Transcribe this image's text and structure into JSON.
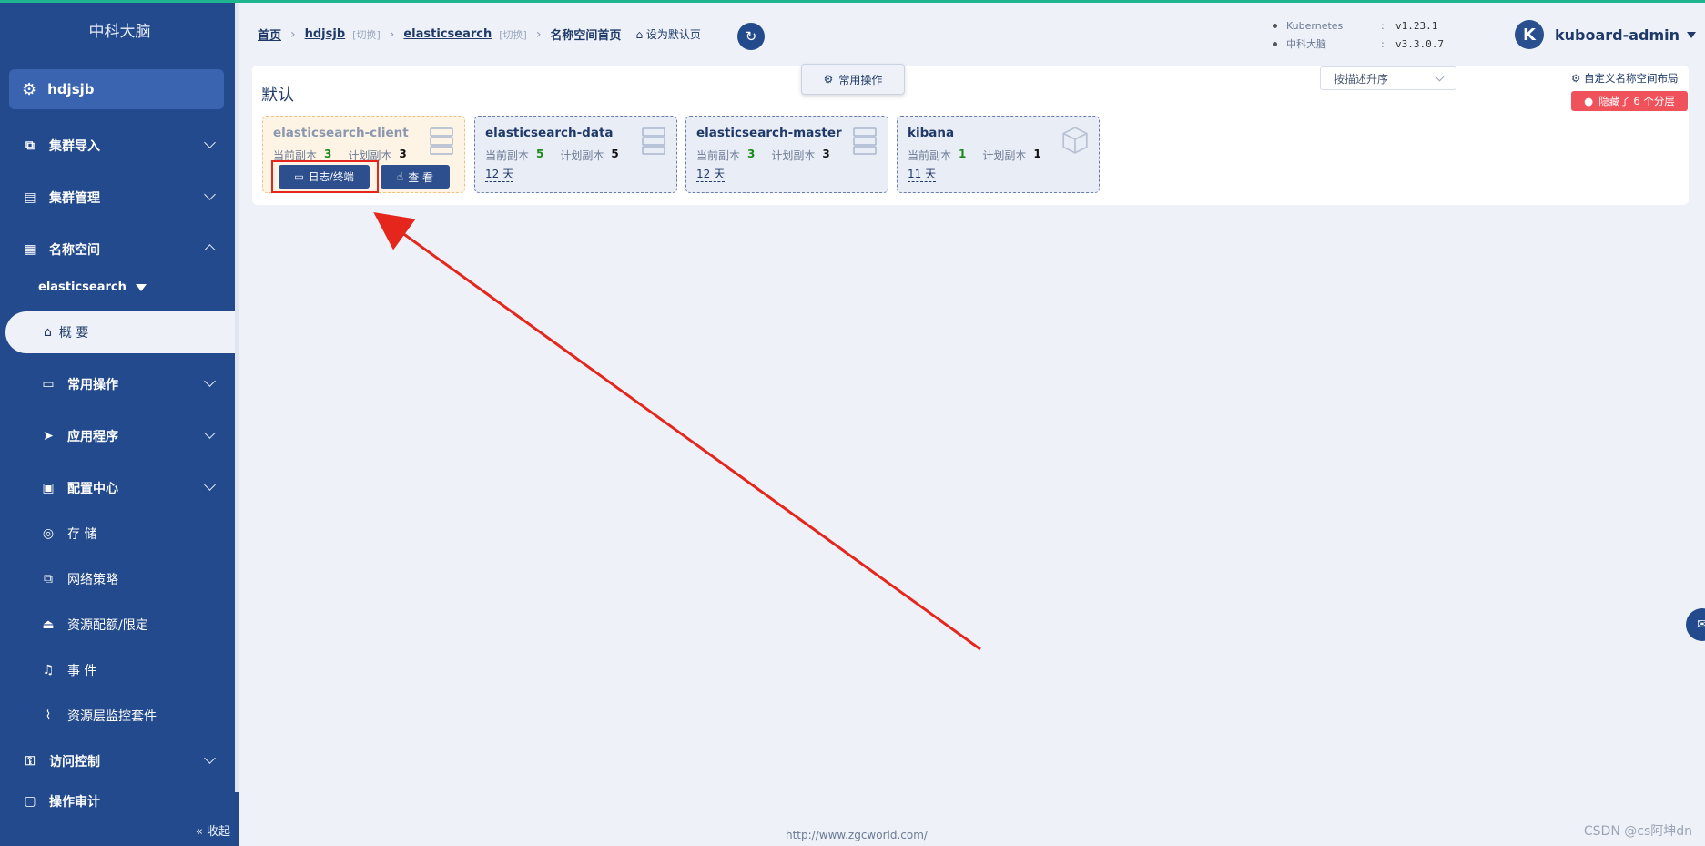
{
  "sidebar": {
    "title": "中科大脑",
    "cluster": "hdjsjb",
    "items": [
      {
        "label": "集群导入"
      },
      {
        "label": "集群管理"
      },
      {
        "label": "名称空间"
      },
      {
        "label": "常用操作"
      },
      {
        "label": "应用程序"
      },
      {
        "label": "配置中心"
      },
      {
        "label": "存 储"
      },
      {
        "label": "网络策略"
      },
      {
        "label": "资源配额/限定"
      },
      {
        "label": "事 件"
      },
      {
        "label": "资源层监控套件"
      },
      {
        "label": "访问控制"
      },
      {
        "label": "操作审计"
      }
    ],
    "namespace": "elasticsearch",
    "active": "概 要",
    "collapse": "收起"
  },
  "breadcrumb": {
    "home": "首页",
    "cluster": "hdjsjb",
    "switch1": "[切换]",
    "namespace": "elasticsearch",
    "switch2": "[切换]",
    "current": "名称空间首页",
    "set_default": "设为默认页"
  },
  "versions": [
    {
      "name": "Kubernetes",
      "sep": ":",
      "value": "v1.23.1"
    },
    {
      "name": "中科大脑",
      "sep": ":",
      "value": "v3.3.0.7"
    }
  ],
  "user": {
    "initial": "K",
    "name": "kuboard-admin"
  },
  "panel": {
    "title": "默认",
    "common_ops": "常用操作",
    "sort": "按描述升序",
    "custom_layout": "自定义名称空间布局",
    "hidden_badge": "隐藏了 6 个分层"
  },
  "cards": [
    {
      "name": "elasticsearch-client",
      "cur_label": "当前副本",
      "cur": "3",
      "plan_label": "计划副本",
      "plan": "3",
      "age": "",
      "btn_log": "日志/终端",
      "btn_view": "查 看"
    },
    {
      "name": "elasticsearch-data",
      "cur_label": "当前副本",
      "cur": "5",
      "plan_label": "计划副本",
      "plan": "5",
      "age": "12 天"
    },
    {
      "name": "elasticsearch-master",
      "cur_label": "当前副本",
      "cur": "3",
      "plan_label": "计划副本",
      "plan": "3",
      "age": "12 天"
    },
    {
      "name": "kibana",
      "cur_label": "当前副本",
      "cur": "1",
      "plan_label": "计划副本",
      "plan": "1",
      "age": "11 天"
    }
  ],
  "footer": {
    "url": "http://www.zgcworld.com/",
    "watermark": "CSDN @cs阿坤dn"
  },
  "colors": {
    "sidebar": "#234a8c",
    "accent": "#2d4f8e",
    "danger": "#f0525c",
    "highlight": "#e5261d"
  }
}
